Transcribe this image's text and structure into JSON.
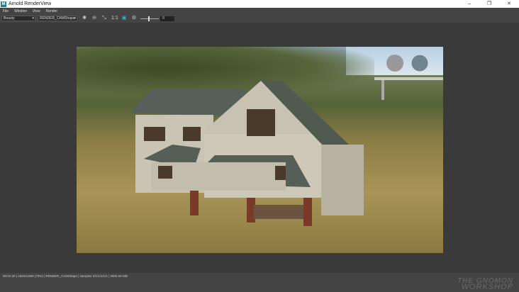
{
  "window": {
    "title": "Arnold RenderView",
    "app_logo": "M"
  },
  "menu": [
    "File",
    "Window",
    "View",
    "Render"
  ],
  "toolbar": {
    "aov": "Beauty",
    "camera": "RENDER_CAMShape",
    "ratio": "1:1",
    "exposure": "0",
    "record_color": "#d02030"
  },
  "status": {
    "text": "00:01:20 | 1920x1080 (70%) | RENDER_CAMShape | samples 2/1/1/1/1/1 | 2606.08 MB"
  },
  "watermark": {
    "line1": "THE GNOMON",
    "line2": "WORKSHOP"
  }
}
